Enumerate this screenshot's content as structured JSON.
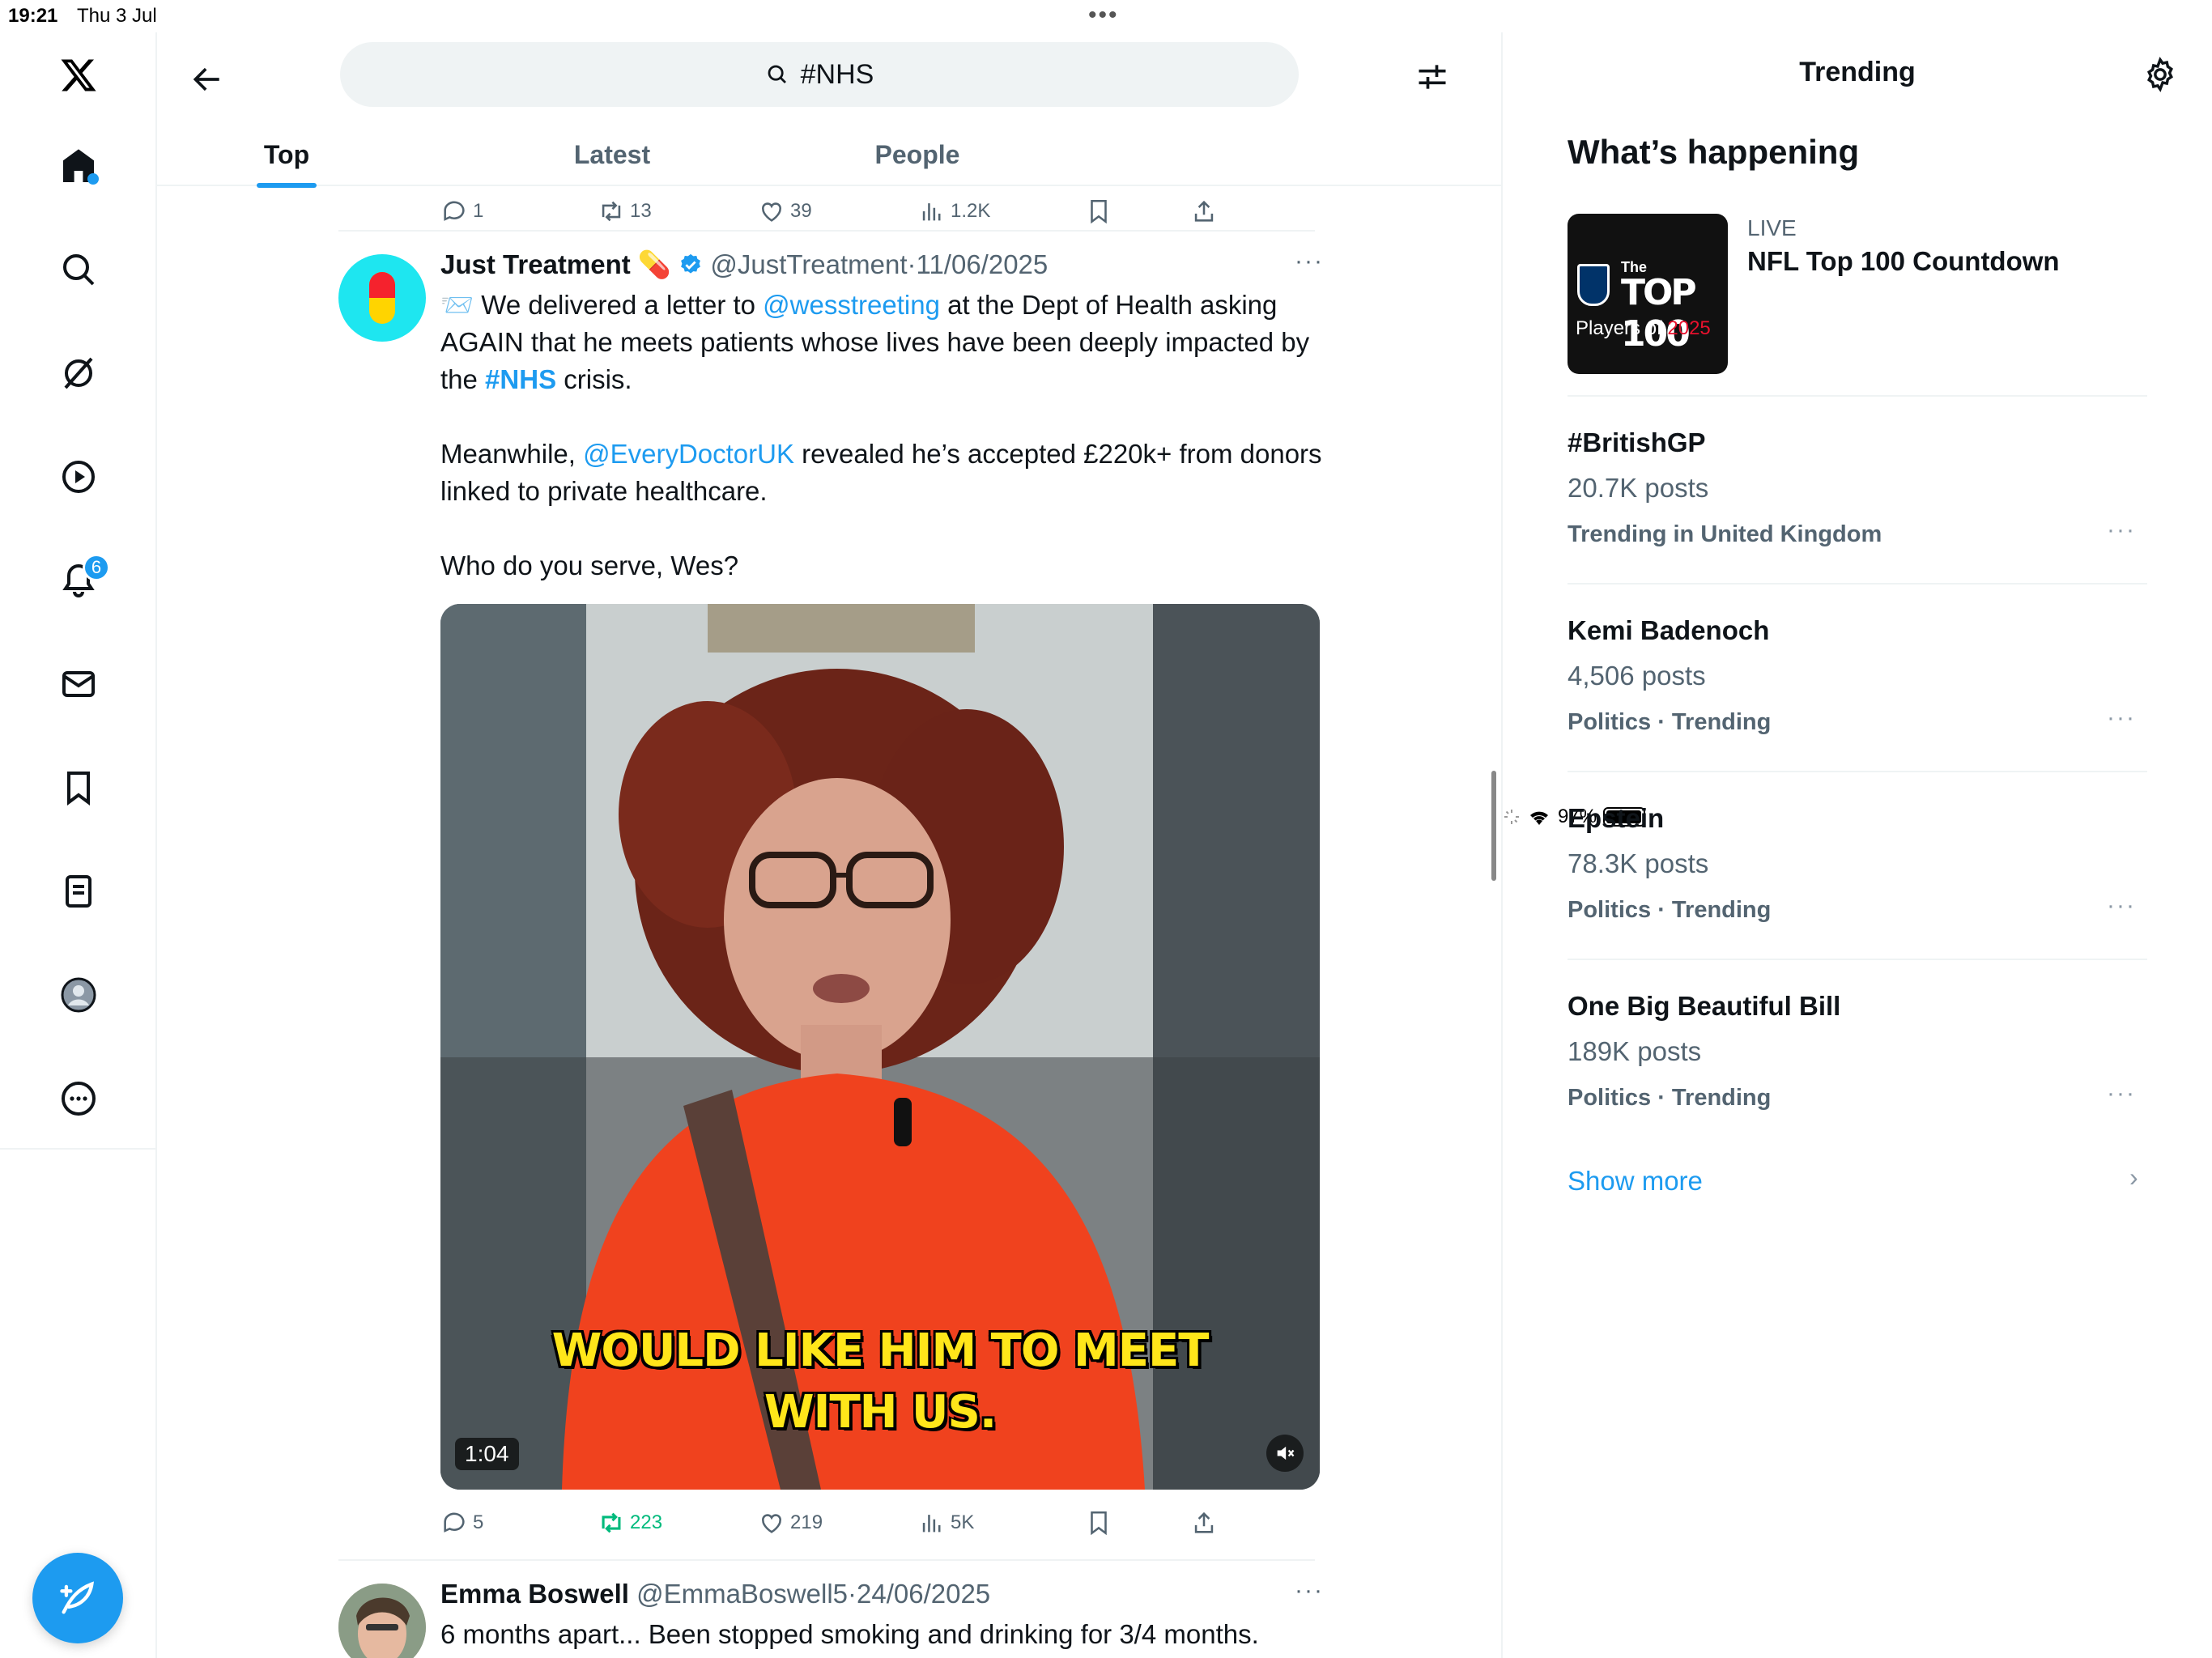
{
  "status_bar": {
    "time": "19:21",
    "date": "Thu 3 Jul",
    "battery": "97%",
    "battery_level": 0.97
  },
  "nav": {
    "icons": [
      "x-logo-icon",
      "home-icon",
      "search-icon",
      "grok-icon",
      "video-icon",
      "notifications-icon",
      "messages-icon",
      "bookmarks-icon",
      "lists-icon",
      "profile-icon",
      "more-icon"
    ],
    "notification_count": "6",
    "compose_icon": "compose-feather-icon"
  },
  "header": {
    "search_query": "#NHS",
    "tabs": [
      {
        "label": "Top",
        "active": true
      },
      {
        "label": "Latest",
        "active": false
      },
      {
        "label": "People",
        "active": false
      }
    ]
  },
  "previous_tweet_actions": {
    "replies": "1",
    "reposts": "13",
    "likes": "39",
    "views": "1.2K"
  },
  "tweet": {
    "author_name": "Just Treatment",
    "author_emoji": "💊",
    "verified": true,
    "handle": "@JustTreatment",
    "separator": "·",
    "date": "11/06/2025",
    "text": {
      "p1_emoji": "📨",
      "p1_a": " We delivered a letter to ",
      "p1_mention": "@wesstreeting",
      "p1_b": " at the Dept of Health asking AGAIN that he meets patients whose lives have been deeply impacted by the ",
      "p1_hashtag": "#NHS",
      "p1_c": " crisis.",
      "p2_a": "Meanwhile, ",
      "p2_mention": "@EveryDoctorUK",
      "p2_b": " revealed he’s accepted £220k+ from donors linked to private healthcare.",
      "p3": "Who do you serve, Wes?"
    },
    "video": {
      "caption_line1": "WOULD LIKE HIM TO MEET",
      "caption_line2": "WITH US.",
      "duration": "1:04"
    },
    "actions": {
      "replies": "5",
      "reposts": "223",
      "likes": "219",
      "views": "5K"
    },
    "repost_color": "#00ba7c"
  },
  "next_tweet": {
    "author_name": "Emma Boswell",
    "handle": "@EmmaBoswell5",
    "separator": "·",
    "date": "24/06/2025",
    "text": "6 months apart... Been stopped smoking and drinking for 3/4 months."
  },
  "sidebar": {
    "title": "Trending",
    "section_title": "What’s happening",
    "live": {
      "label": "LIVE",
      "title": "NFL Top 100 Countdown",
      "thumb_line1": "The",
      "thumb_line2": "TOP 100",
      "thumb_line3a": "Players of ",
      "thumb_line3b": "2025"
    },
    "trends": [
      {
        "name": "#BritishGP",
        "posts": "20.7K posts",
        "category": "Trending in United Kingdom"
      },
      {
        "name": "Kemi Badenoch",
        "posts": "4,506 posts",
        "category": "Politics · Trending"
      },
      {
        "name": "Epstein",
        "posts": "78.3K posts",
        "category": "Politics · Trending"
      },
      {
        "name": "One Big Beautiful Bill",
        "posts": "189K posts",
        "category": "Politics · Trending"
      }
    ],
    "show_more": "Show more"
  },
  "colors": {
    "accent": "#1d9bf0",
    "text_primary": "#0f1419",
    "text_secondary": "#536471",
    "divider": "#eff3f4"
  }
}
